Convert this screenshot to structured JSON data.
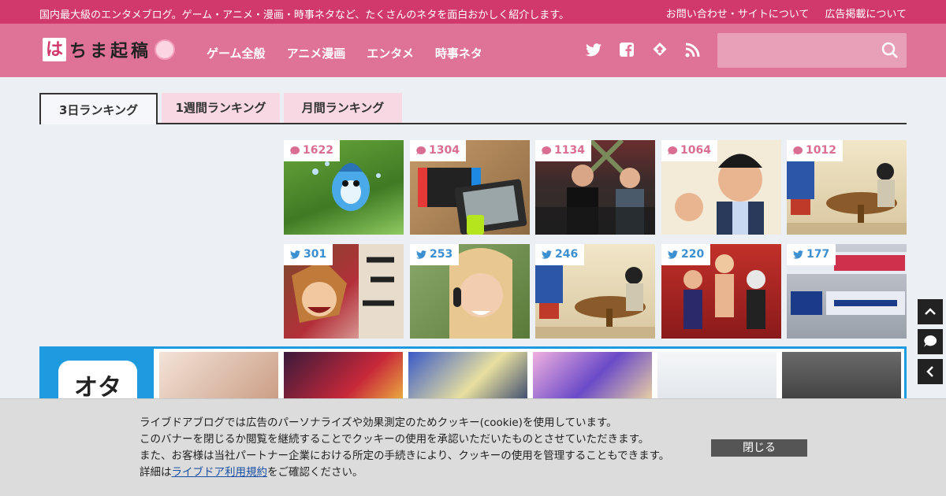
{
  "topbar": {
    "tagline": "国内最大級のエンタメブログ。ゲーム・アニメ・漫画・時事ネタなど、たくさんのネタを面白おかしく紹介します。",
    "links": [
      "お問い合わせ・サイトについて",
      "広告掲載について"
    ]
  },
  "header": {
    "logo_text": "ちま起稿",
    "logo_badge": "は",
    "nav": [
      "ゲーム全般",
      "アニメ漫画",
      "エンタメ",
      "時事ネタ"
    ],
    "social_icons": [
      "twitter-icon",
      "facebook-icon",
      "feedly-icon",
      "rss-icon"
    ],
    "search": {
      "placeholder": "",
      "value": ""
    }
  },
  "tabs": [
    {
      "label": "3日ランキング",
      "active": true
    },
    {
      "label": "1週間ランキング",
      "active": false
    },
    {
      "label": "月間ランキング",
      "active": false
    }
  ],
  "ranking": {
    "comment_row": [
      "1622",
      "1304",
      "1134",
      "1064",
      "1012"
    ],
    "tweet_row": [
      "301",
      "253",
      "246",
      "220",
      "177"
    ]
  },
  "colors": {
    "topbar": "#d1396d",
    "header": "#df7297",
    "comment_badge": "#d96d92",
    "tweet_badge": "#3c8fd1",
    "promo": "#1e9be0"
  },
  "promo": {
    "app_label": "オタ"
  },
  "cookie": {
    "line1": "ライブドアブログでは広告のパーソナライズや効果測定のためクッキー(cookie)を使用しています。",
    "line2": "このバナーを閉じるか閲覧を継続することでクッキーの使用を承認いただいたものとさせていただきます。",
    "line3": "また、お客様は当社パートナー企業における所定の手続きにより、クッキーの使用を管理することもできます。",
    "line4_prefix": "詳細は",
    "line4_link": "ライブドア利用規約",
    "line4_suffix": "をご確認ください。",
    "close_label": "閉じる"
  }
}
